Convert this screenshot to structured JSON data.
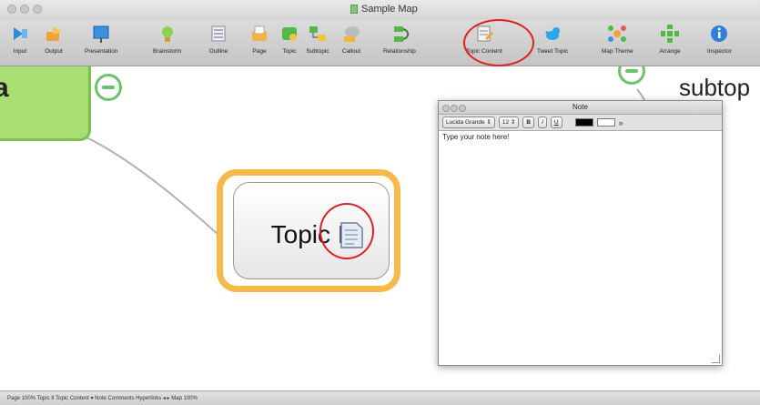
{
  "window": {
    "title": "Sample Map"
  },
  "toolbar": {
    "items": [
      {
        "label": "Input"
      },
      {
        "label": "Output"
      },
      {
        "label": "Presentation"
      },
      {
        "label": "Brainstorm"
      },
      {
        "label": "Outline"
      },
      {
        "label": "Page"
      },
      {
        "label": "Topic"
      },
      {
        "label": "Subtopic"
      },
      {
        "label": "Callout"
      },
      {
        "label": "Relationship"
      },
      {
        "label": "Topic Content"
      },
      {
        "label": "Tweet Topic"
      },
      {
        "label": "Map Theme"
      },
      {
        "label": "Arrange"
      },
      {
        "label": "Inspector"
      }
    ]
  },
  "map": {
    "central_topic": "lea",
    "topic": "Topic II",
    "subtopic": "subtop"
  },
  "note": {
    "title": "Note",
    "font": "Lucida Grande",
    "font_size": "12",
    "bold": "B",
    "italic": "I",
    "underline": "U",
    "placeholder": "Type your note here!"
  },
  "status": {
    "text": "Page   100%   Topic II   Topic Content ▾   Note   Comments   Hyperlinks   ◂ ▸   Map   100%"
  },
  "colors": {
    "highlight_circle": "#e02020",
    "topic_outline": "#f6b94a",
    "central_fill": "#a8df74"
  }
}
